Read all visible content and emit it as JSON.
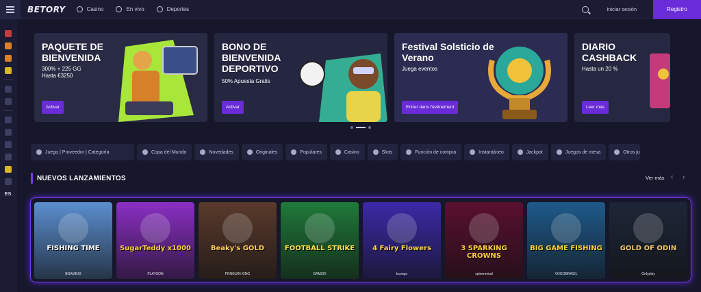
{
  "header": {
    "logo": "BETORY",
    "nav": [
      {
        "label": "Casino",
        "icon": "chip-icon"
      },
      {
        "label": "En vivo",
        "icon": "live-icon"
      },
      {
        "label": "Deportes",
        "icon": "ball-icon"
      }
    ],
    "login_label": "Iniciar sesión",
    "register_label": "Registro"
  },
  "sidebar": {
    "lang": "ES"
  },
  "banners": [
    {
      "title": "PAQUETE DE BIENVENIDA",
      "subtitle": "300% + 225 GG\nHasta €3250",
      "cta": "Activar"
    },
    {
      "title": "BONO DE BIENVENIDA DEPORTIVO",
      "subtitle": "50% Apuesta Gratis",
      "cta": "Activar"
    },
    {
      "title": "Festival Solsticio de Verano",
      "subtitle": "Juega eventos",
      "cta": "Entrer dans l'évènement"
    },
    {
      "title": "DIARIO CASHBACK",
      "subtitle": "Hasta un 20 %",
      "cta": "Leer más"
    }
  ],
  "filters": {
    "search_placeholder": "Juego | Proveedor | Categoría",
    "chips": [
      "Copa del Mundo",
      "Novedades",
      "Originales",
      "Populares",
      "Casino",
      "Slots",
      "Función de compra",
      "Instantáneo",
      "Jackpot",
      "Juegos de mesa",
      "Otros ju"
    ]
  },
  "section": {
    "title": "NUEVOS LANZAMIENTOS",
    "see_more": "Ver más"
  },
  "games": [
    {
      "name": "FISHING TIME",
      "provider": "BGAMING",
      "bg": "#5b8fd0",
      "color": "#ffffff"
    },
    {
      "name": "SugarTeddy x1000",
      "provider": "PLAYSON",
      "bg": "#8a2fc4",
      "color": "#ffd23c"
    },
    {
      "name": "Beaky's GOLD",
      "provider": "PENGUIN KING",
      "bg": "#5a3a2c",
      "color": "#ffcf5a"
    },
    {
      "name": "FOOTBALL STRIKE",
      "provider": "GAMZIX",
      "bg": "#1f7a3a",
      "color": "#ffe14a"
    },
    {
      "name": "4 Fairy Flowers",
      "provider": "bcongo",
      "bg": "#3a2aa8",
      "color": "#ffd84a"
    },
    {
      "name": "3 SPARKING CROWNS",
      "provider": "spinomenal",
      "bg": "#5a1030",
      "color": "#ffcf3a"
    },
    {
      "name": "BIG GAME FISHING",
      "provider": "VOGOBRASIL",
      "bg": "#1e5a8a",
      "color": "#ffd43a"
    },
    {
      "name": "GOLD OF ODIN",
      "provider": "Onlyplay",
      "bg": "#1d2638",
      "color": "#f2c86a"
    }
  ]
}
